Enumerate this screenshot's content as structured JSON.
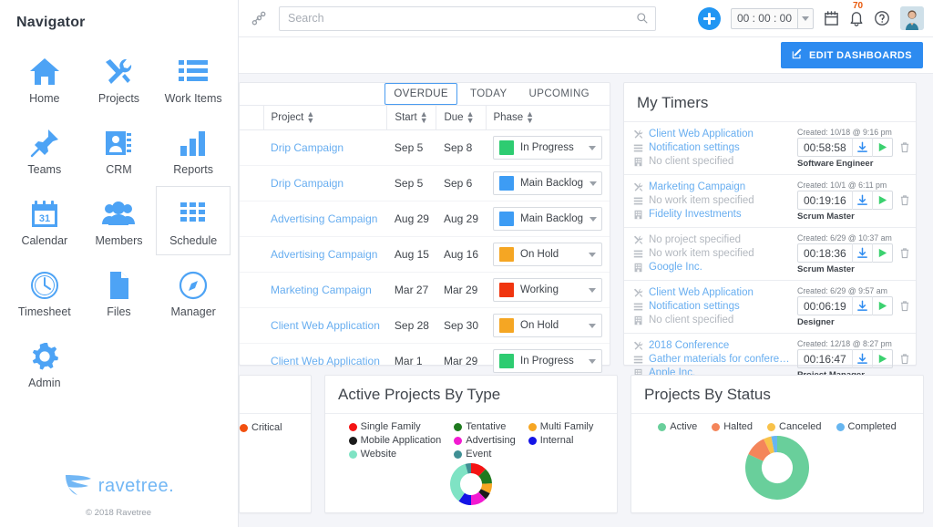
{
  "sidebar": {
    "title": "Navigator",
    "items": [
      {
        "label": "Home",
        "icon": "home-icon",
        "selected": false
      },
      {
        "label": "Projects",
        "icon": "tools-icon",
        "selected": false
      },
      {
        "label": "Work Items",
        "icon": "list-icon",
        "selected": false
      },
      {
        "label": "Teams",
        "icon": "pin-icon",
        "selected": false
      },
      {
        "label": "CRM",
        "icon": "contact-card-icon",
        "selected": false
      },
      {
        "label": "Reports",
        "icon": "bar-chart-icon",
        "selected": false
      },
      {
        "label": "Calendar",
        "icon": "calendar-31-icon",
        "selected": false
      },
      {
        "label": "Members",
        "icon": "people-icon",
        "selected": false
      },
      {
        "label": "Schedule",
        "icon": "grid-icon",
        "selected": true
      },
      {
        "label": "Timesheet",
        "icon": "clock-icon",
        "selected": false
      },
      {
        "label": "Files",
        "icon": "file-icon",
        "selected": false
      },
      {
        "label": "Manager",
        "icon": "compass-icon",
        "selected": false
      },
      {
        "label": "Admin",
        "icon": "gear-icon",
        "selected": false
      }
    ],
    "brand_name": "ravetree.",
    "copyright": "© 2018 Ravetree"
  },
  "topbar": {
    "link_icon": "link-chain-icon",
    "search_placeholder": "Search",
    "search_value": "",
    "search_icon": "search-icon",
    "add_icon": "plus-icon",
    "timer_value": "00 : 00 : 00",
    "timer_caret_icon": "chevron-down-icon",
    "calendar_icon": "calendar-icon",
    "bell_icon": "bell-icon",
    "notification_count": "70",
    "help_icon": "question-circle-icon",
    "avatar_icon": "user-avatar"
  },
  "actionbar": {
    "edit_dashboards_label": "EDIT DASHBOARDS",
    "edit_icon": "pencil-square-icon"
  },
  "work_items": {
    "tabs": [
      {
        "label": "OVERDUE",
        "active": true
      },
      {
        "label": "TODAY",
        "active": false
      },
      {
        "label": "UPCOMING",
        "active": false
      }
    ],
    "columns": [
      "",
      "Project",
      "Start",
      "Due",
      "Phase"
    ],
    "rows": [
      {
        "project": "Drip Campaign",
        "start": "Sep 5",
        "due": "Sep 8",
        "phase": "In Progress",
        "phase_color": "#2ecc71"
      },
      {
        "project": "Drip Campaign",
        "start": "Sep 5",
        "due": "Sep 6",
        "phase": "Main Backlog",
        "phase_color": "#3d9cf4"
      },
      {
        "project": "Advertising Campaign",
        "start": "Aug 29",
        "due": "Aug 29",
        "phase": "Main Backlog",
        "phase_color": "#3d9cf4"
      },
      {
        "project": "Advertising Campaign",
        "start": "Aug 15",
        "due": "Aug 16",
        "phase": "On Hold",
        "phase_color": "#f5a623"
      },
      {
        "project": "Marketing Campaign",
        "start": "Mar 27",
        "due": "Mar 29",
        "phase": "Working",
        "phase_color": "#f0350f"
      },
      {
        "project": "Client Web Application",
        "start": "Sep 28",
        "due": "Sep 30",
        "phase": "On Hold",
        "phase_color": "#f5a623"
      },
      {
        "project": "Client Web Application",
        "start": "Mar 1",
        "due": "Mar 29",
        "phase": "In Progress",
        "phase_color": "#2ecc71"
      }
    ]
  },
  "my_timers": {
    "title": "My Timers",
    "project_icon": "tools-icon",
    "work_item_icon": "list-icon",
    "client_icon": "building-icon",
    "download_icon": "download-icon",
    "play_icon": "play-icon",
    "delete_icon": "trash-icon",
    "rows": [
      {
        "project": "Client Web Application",
        "project_muted": false,
        "work_item": "Notification settings",
        "work_item_muted": false,
        "client": "No client specified",
        "client_muted": true,
        "created": "Created: 10/18 @ 9:16 pm",
        "time": "00:58:58",
        "role": "Software Engineer"
      },
      {
        "project": "Marketing Campaign",
        "project_muted": false,
        "work_item": "No work item specified",
        "work_item_muted": true,
        "client": "Fidelity Investments",
        "client_muted": false,
        "created": "Created: 10/1 @ 6:11 pm",
        "time": "00:19:16",
        "role": "Scrum Master"
      },
      {
        "project": "No project specified",
        "project_muted": true,
        "work_item": "No work item specified",
        "work_item_muted": true,
        "client": "Google Inc.",
        "client_muted": false,
        "created": "Created: 6/29 @ 10:37 am",
        "time": "00:18:36",
        "role": "Scrum Master"
      },
      {
        "project": "Client Web Application",
        "project_muted": false,
        "work_item": "Notification settings",
        "work_item_muted": false,
        "client": "No client specified",
        "client_muted": true,
        "created": "Created: 6/29 @ 9:57 am",
        "time": "00:06:19",
        "role": "Designer"
      },
      {
        "project": "2018 Conference",
        "project_muted": false,
        "work_item": "Gather materials for conference",
        "work_item_muted": false,
        "client": "Apple Inc.",
        "client_muted": false,
        "created": "Created: 12/18 @ 8:27 pm",
        "time": "00:16:47",
        "role": "Project Manager"
      }
    ]
  },
  "critical_card": {
    "legend": [
      {
        "label": "Critical",
        "color": "#f2500f"
      }
    ]
  },
  "chart_data": [
    {
      "type": "pie",
      "title": "Active Projects By Type",
      "legend_position": "top",
      "categories": [
        "Single Family",
        "Tentative",
        "Multi Family",
        "Mobile Application",
        "Advertising",
        "Internal",
        "Website",
        "Event"
      ],
      "colors": [
        "#f41414",
        "#1f7a1f",
        "#f6a623",
        "#1b1b1b",
        "#f21ad1",
        "#1414e6",
        "#7fe3c4",
        "#3f8f94"
      ],
      "values": [
        11,
        11,
        7,
        5,
        11,
        9,
        32,
        4
      ],
      "xlabel": "",
      "ylabel": ""
    },
    {
      "type": "pie",
      "title": "Projects By Status",
      "legend_position": "top",
      "categories": [
        "Active",
        "Halted",
        "Canceled",
        "Completed"
      ],
      "colors": [
        "#69cf9b",
        "#f4855a",
        "#f8c24a",
        "#67b6f0"
      ],
      "values": [
        82,
        11,
        4,
        3
      ],
      "xlabel": "",
      "ylabel": ""
    }
  ]
}
